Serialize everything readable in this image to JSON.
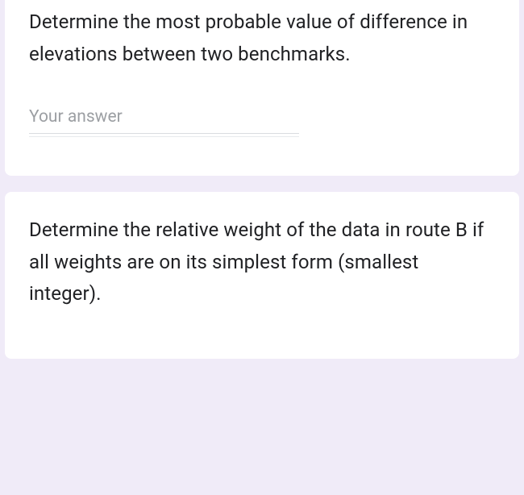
{
  "questions": [
    {
      "text": "Determine the most probable value of difference in elevations between two benchmarks.",
      "answer_placeholder": "Your answer"
    },
    {
      "text": "Determine the relative weight of the data in route B if all weights are on its simplest form (smallest integer)."
    }
  ]
}
